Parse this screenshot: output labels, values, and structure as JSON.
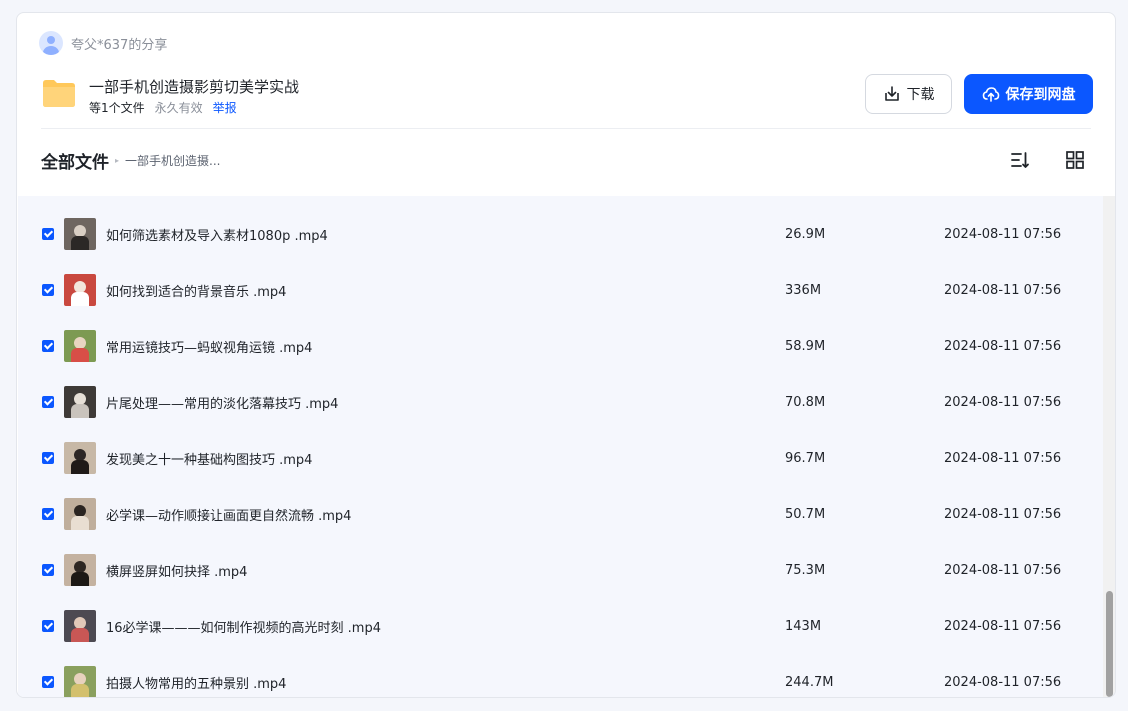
{
  "sharer": {
    "name": "夸父*637的分享"
  },
  "share": {
    "title": "一部手机创造摄影剪切美学实战",
    "count": "等1个文件",
    "validity": "永久有效",
    "report": "举报"
  },
  "actions": {
    "download": "下载",
    "save": "保存到网盘"
  },
  "breadcrumb": {
    "root": "全部文件",
    "separator": "▸",
    "current": "一部手机创造摄..."
  },
  "colors": {
    "accent": "#0b57ff",
    "folder": "#ffc85a",
    "list_bg": "#f5f7fd"
  },
  "files": [
    {
      "name": "如何筛选素材及导入素材1080p .mp4",
      "size": "26.9M",
      "date": "2024-08-11 07:56",
      "checked": true
    },
    {
      "name": "如何找到适合的背景音乐 .mp4",
      "size": "336M",
      "date": "2024-08-11 07:56",
      "checked": true
    },
    {
      "name": "常用运镜技巧—蚂蚁视角运镜 .mp4",
      "size": "58.9M",
      "date": "2024-08-11 07:56",
      "checked": true
    },
    {
      "name": "片尾处理——常用的淡化落幕技巧 .mp4",
      "size": "70.8M",
      "date": "2024-08-11 07:56",
      "checked": true
    },
    {
      "name": "发现美之十一种基础构图技巧 .mp4",
      "size": "96.7M",
      "date": "2024-08-11 07:56",
      "checked": true
    },
    {
      "name": "必学课—动作顺接让画面更自然流畅 .mp4",
      "size": "50.7M",
      "date": "2024-08-11 07:56",
      "checked": true
    },
    {
      "name": "横屏竖屏如何抉择 .mp4",
      "size": "75.3M",
      "date": "2024-08-11 07:56",
      "checked": true
    },
    {
      "name": "16必学课———如何制作视频的高光时刻 .mp4",
      "size": "143M",
      "date": "2024-08-11 07:56",
      "checked": true
    },
    {
      "name": "拍摄人物常用的五种景别 .mp4",
      "size": "244.7M",
      "date": "2024-08-11 07:56",
      "checked": true
    }
  ]
}
